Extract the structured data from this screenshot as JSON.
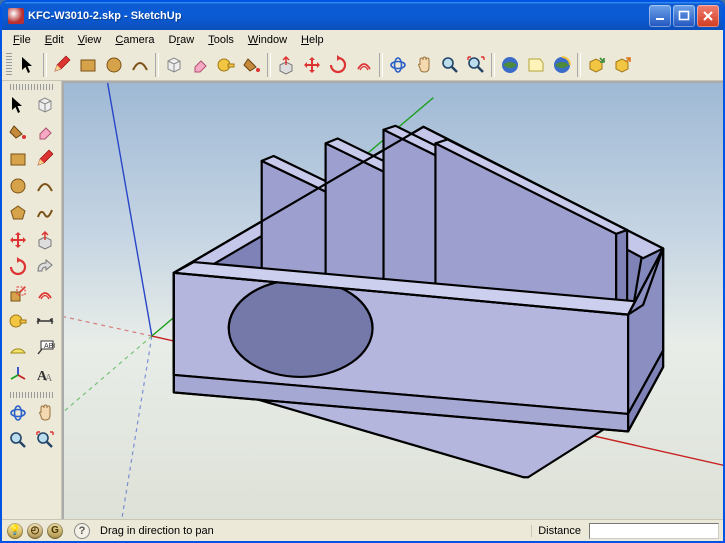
{
  "window": {
    "title": "KFC-W3010-2.skp - SketchUp"
  },
  "menu": {
    "file": "File",
    "edit": "Edit",
    "view": "View",
    "camera": "Camera",
    "draw": "Draw",
    "tools": "Tools",
    "window": "Window",
    "help": "Help"
  },
  "status": {
    "hint": "Drag in direction to pan",
    "distance_label": "Distance",
    "distance_value": ""
  },
  "colors": {
    "axis_red": "#c62020",
    "axis_green": "#1aa01a",
    "axis_blue": "#2846c8",
    "model_face": "#b5b6de",
    "model_dark": "#7e82b6",
    "model_edge": "#000000"
  },
  "icons": {
    "select": "select-arrow-icon",
    "pencil": "pencil-icon",
    "rectangle": "rectangle-icon",
    "circle": "circle-icon",
    "arc": "arc-icon",
    "make_component": "component-icon",
    "eraser": "eraser-icon",
    "tape": "tape-measure-icon",
    "paint": "paint-bucket-icon",
    "pushpull": "push-pull-icon",
    "move": "move-icon",
    "rotate": "rotate-icon",
    "offset": "offset-icon",
    "orbit": "orbit-icon",
    "pan": "pan-icon",
    "zoom": "zoom-icon",
    "zoom_extents": "zoom-extents-icon",
    "ge_model": "get-models-icon",
    "ge_prev": "ge-preview-icon",
    "ge_place": "ge-place-icon",
    "ge_toggle": "ge-toggle-icon",
    "ge_export": "ge-export-icon"
  }
}
